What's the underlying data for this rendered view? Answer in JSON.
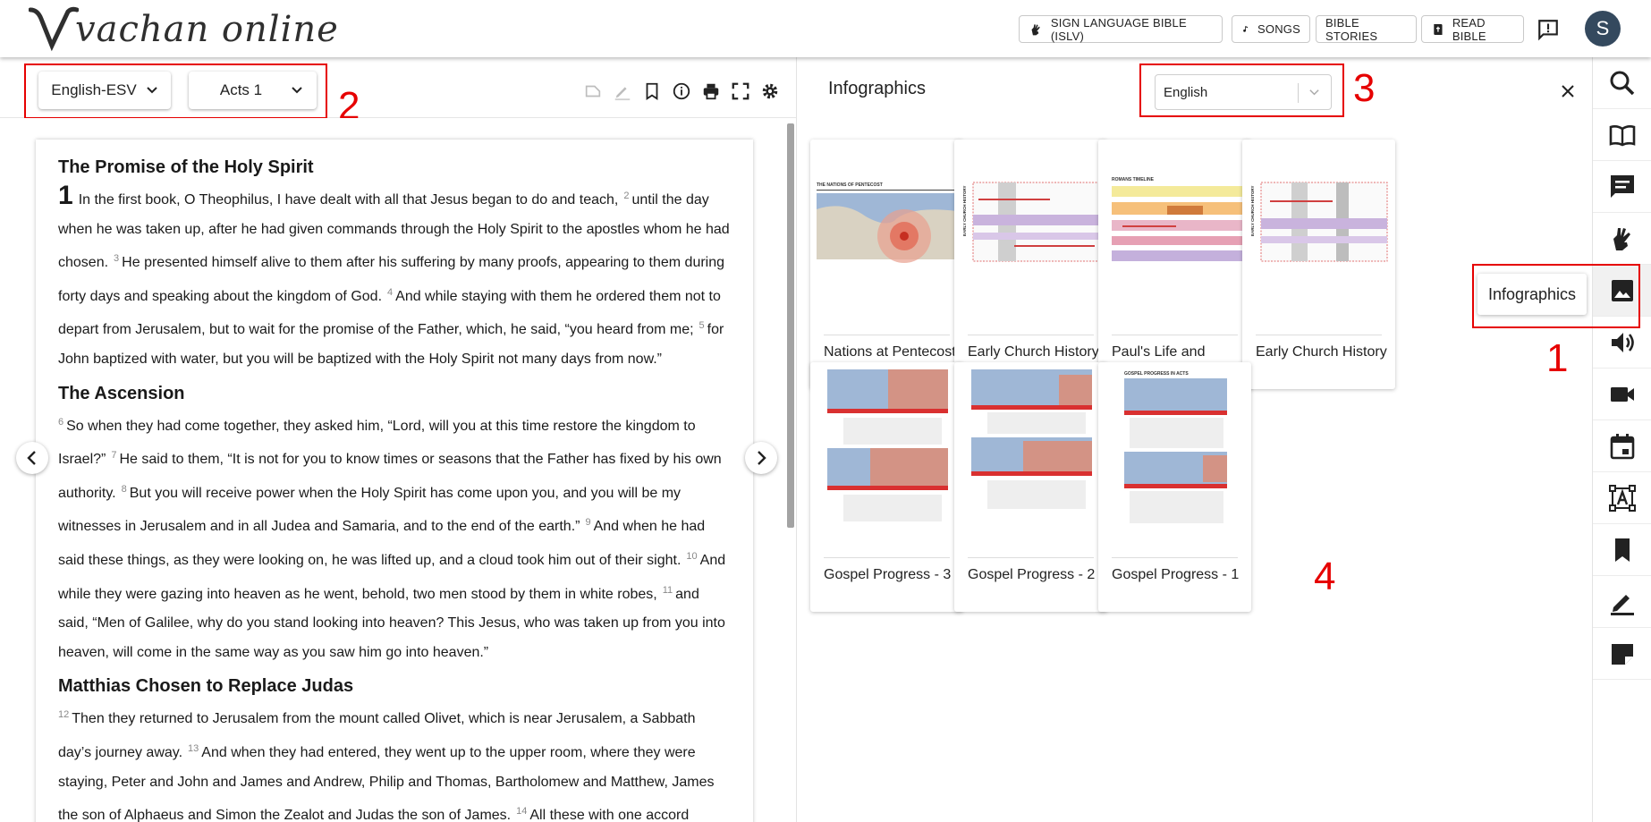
{
  "brand": {
    "logo_text": "vachan online"
  },
  "header": {
    "sign_language": "SIGN LANGUAGE BIBLE (ISLV)",
    "songs": "SONGS",
    "bible_stories": "BIBLE STORIES",
    "read_bible": "READ BIBLE",
    "avatar_initial": "S"
  },
  "toolbar": {
    "version": "English-ESV",
    "chapter": "Acts 1"
  },
  "reader": {
    "sections": [
      {
        "heading": "The Promise of the Holy Spirit"
      },
      {
        "heading": "The Ascension"
      },
      {
        "heading": "Matthias Chosen to Replace Judas"
      }
    ],
    "chapter_number": "1",
    "verses": [
      {
        "n": "1",
        "t": "In the first book, O Theophilus, I have dealt with all that Jesus began to do and teach,"
      },
      {
        "n": "2",
        "t": "until the day when he was taken up, after he had given commands through the Holy Spirit to the apostles whom he had chosen."
      },
      {
        "n": "3",
        "t": "He presented himself alive to them after his suffering by many proofs, appearing to them during forty days and speaking about the kingdom of God."
      },
      {
        "n": "4",
        "t": "And while staying with them he ordered them not to depart from Jerusalem, but to wait for the promise of the Father, which, he said, “you heard from me;"
      },
      {
        "n": "5",
        "t": "for John baptized with water, but you will be baptized with the Holy Spirit not many days from now.”"
      },
      {
        "n": "6",
        "t": "So when they had come together, they asked him, “Lord, will you at this time restore the kingdom to Israel?”"
      },
      {
        "n": "7",
        "t": "He said to them, “It is not for you to know times or seasons that the Father has fixed by his own authority."
      },
      {
        "n": "8",
        "t": "But you will receive power when the Holy Spirit has come upon you, and you will be my witnesses in Jerusalem and in all Judea and Samaria, and to the end of the earth.”"
      },
      {
        "n": "9",
        "t": "And when he had said these things, as they were looking on, he was lifted up, and a cloud took him out of their sight."
      },
      {
        "n": "10",
        "t": "And while they were gazing into heaven as he went, behold, two men stood by them in white robes,"
      },
      {
        "n": "11",
        "t": "and said, “Men of Galilee, why do you stand looking into heaven? This Jesus, who was taken up from you into heaven, will come in the same way as you saw him go into heaven.”"
      },
      {
        "n": "12",
        "t": "Then they returned to Jerusalem from the mount called Olivet, which is near Jerusalem, a Sabbath day’s journey away."
      },
      {
        "n": "13",
        "t": "And when they had entered, they went up to the upper room, where they were staying, Peter and John and James and Andrew, Philip and Thomas, Bartholomew and Matthew, James the son of Alphaeus and Simon the Zealot and Judas the son of James."
      },
      {
        "n": "14",
        "t": "All these with one accord"
      }
    ]
  },
  "infographics": {
    "title": "Infographics",
    "language": "English",
    "cards": [
      {
        "caption": "Nations at Pentecost",
        "thumb_title": "THE NATIONS OF PENTECOST"
      },
      {
        "caption": "Early Church History",
        "thumb_title": "EARLY CHURCH HISTORY"
      },
      {
        "caption": "Paul's Life and Mission Timeline",
        "thumb_title": "ROMANS TIMELINE"
      },
      {
        "caption": "Early Church History",
        "thumb_title": "EARLY CHURCH HISTORY"
      },
      {
        "caption": "Gospel Progress - 3"
      },
      {
        "caption": "Gospel Progress - 2"
      },
      {
        "caption": "Gospel Progress - 1",
        "thumb_title": "GOSPEL PROGRESS IN ACTS"
      }
    ]
  },
  "sidebar": {
    "tooltip": "Infographics"
  },
  "annotations": {
    "n1": "1",
    "n2": "2",
    "n3": "3",
    "n4": "4"
  },
  "colors": {
    "annotation": "#e60000",
    "avatar": "#34495e"
  }
}
